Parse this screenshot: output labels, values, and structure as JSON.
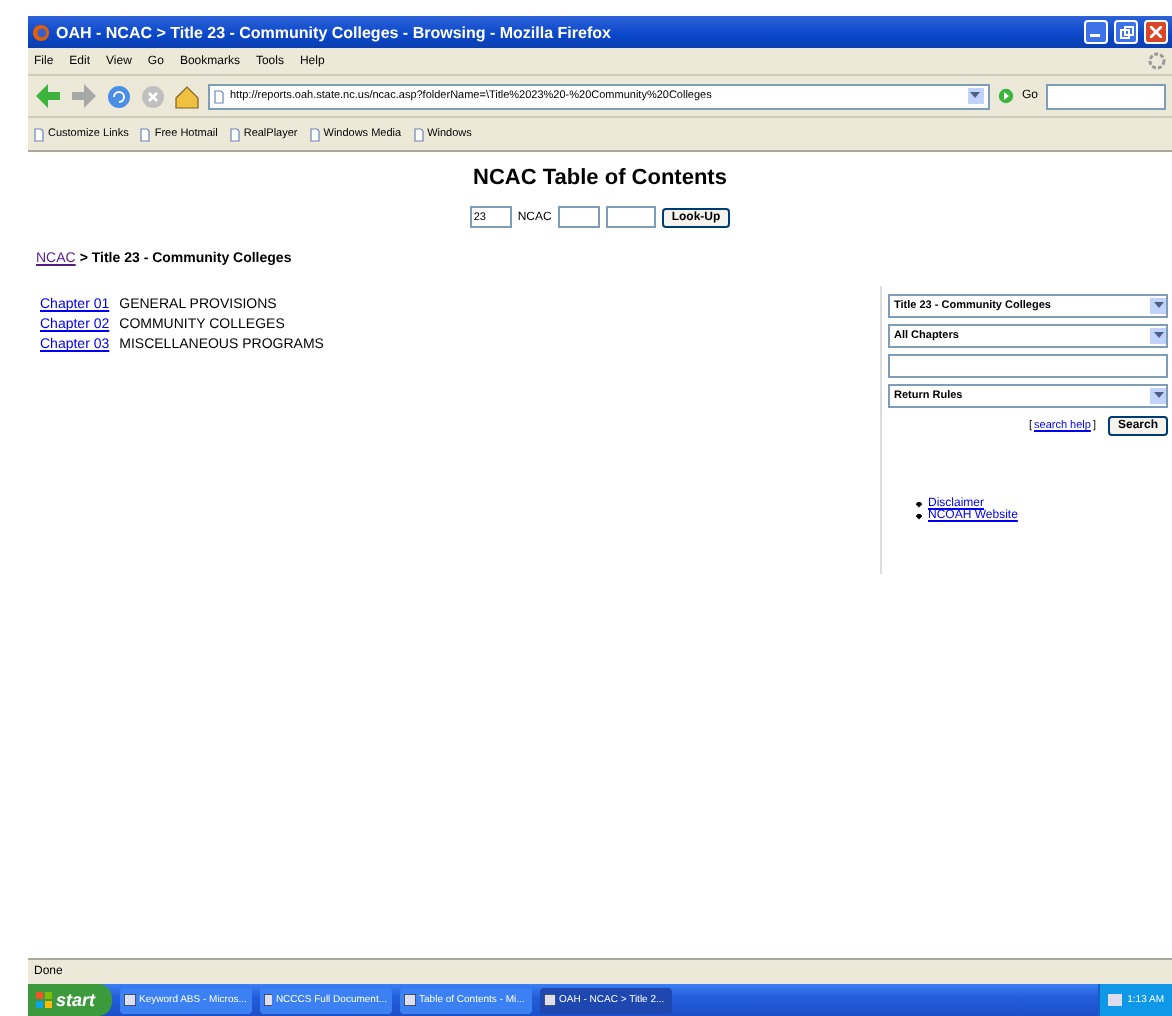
{
  "window": {
    "title": "OAH - NCAC > Title 23 - Community Colleges - Browsing - Mozilla Firefox"
  },
  "menu": [
    "File",
    "Edit",
    "View",
    "Go",
    "Bookmarks",
    "Tools",
    "Help"
  ],
  "toolbar": {
    "url": "http://reports.oah.state.nc.us/ncac.asp?folderName=\\Title%2023%20-%20Community%20Colleges",
    "go": "Go"
  },
  "bookmarks": [
    "Customize Links",
    "Free Hotmail",
    "RealPlayer",
    "Windows Media",
    "Windows"
  ],
  "page": {
    "heading": "NCAC Table of Contents",
    "lookup": {
      "title_value": "23",
      "label": "NCAC",
      "button": "Look-Up"
    },
    "breadcrumb": {
      "link": "NCAC",
      "rest": "> Title 23 - Community Colleges"
    },
    "chapters": [
      {
        "link": "Chapter 01",
        "title": "GENERAL PROVISIONS"
      },
      {
        "link": "Chapter 02",
        "title": "COMMUNITY COLLEGES"
      },
      {
        "link": "Chapter 03",
        "title": "MISCELLANEOUS PROGRAMS"
      }
    ],
    "sidebar": {
      "title_select": "Title 23 - Community Colleges",
      "chapter_select": "All Chapters",
      "return_select": "Return Rules",
      "open_bracket": "[",
      "help_link": "search help",
      "close_bracket": "]",
      "search_button": "Search",
      "links": [
        "Disclaimer",
        "NCOAH Website"
      ]
    }
  },
  "status_bar": "Done",
  "taskbar": {
    "start": "start",
    "tasks": [
      {
        "label": "Keyword ABS - Micros...",
        "selected": false
      },
      {
        "label": "NCCCS Full Document...",
        "selected": false
      },
      {
        "label": "Table of Contents - Mi...",
        "selected": false
      },
      {
        "label": "OAH - NCAC > Title 2...",
        "selected": true
      }
    ],
    "clock": "1:13 AM"
  }
}
